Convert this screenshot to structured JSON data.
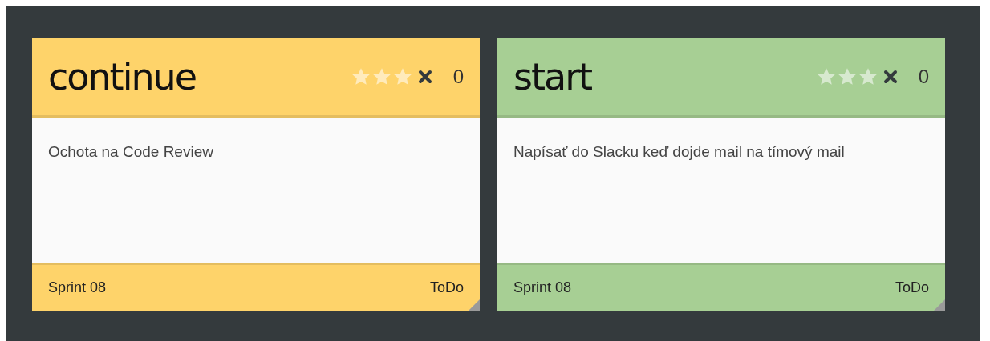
{
  "cards": [
    {
      "title": "continue",
      "color": "#fed36a",
      "votes": "0",
      "text": "Ochota na Code Review",
      "sprint": "Sprint 08",
      "status": "ToDo"
    },
    {
      "title": "start",
      "color": "#a7cf94",
      "votes": "0",
      "text": "Napísať do Slacku keď dojde mail na tímový mail",
      "sprint": "Sprint 08",
      "status": "ToDo"
    }
  ]
}
